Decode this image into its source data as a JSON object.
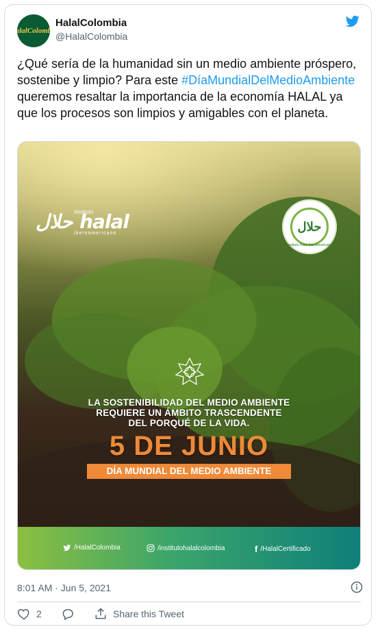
{
  "account": {
    "display_name": "HalalColombia",
    "handle": "@HalalColombia",
    "avatar_text": "HalalColombia"
  },
  "tweet": {
    "text_part1": "¿Qué sería de la humanidad sin un medio ambiente próspero, sostenibe y limpio? Para este ",
    "hashtag": "#DíaMundialDelMedioAmbiente",
    "text_part2": " queremos resaltar la importancia de la economía HALAL ya que los procesos son limpios y amigables con el planeta.",
    "timestamp": "8:01 AM · Jun 5, 2021",
    "like_count": "2",
    "share_label": "Share this Tweet"
  },
  "image": {
    "brand_top": "Instituto",
    "brand_main": "حلال halal",
    "brand_bottom": "iberoamericano",
    "seal_text": "حلال",
    "seal_caption": "Instituto Halal Iberoamericano",
    "message_line1": "LA SOSTENIBILIDAD DEL MEDIO AMBIENTE",
    "message_line2": "REQUIERE UN ÁMBITO TRASCENDENTE",
    "message_line3": "DEL PORQUÉ DE LA VIDA.",
    "date": "5 DE JUNIO",
    "day_label": "DÍA MUNDIAL DEL MEDIO AMBIENTE",
    "social_twitter": "/HalalColombia",
    "social_instagram": "/institutohalalcolombia",
    "social_facebook": "/HalalCertificado"
  },
  "colors": {
    "hashtag": "#1d9bf0",
    "accent_orange": "#ee8a38",
    "brand_green": "#0a5a33"
  }
}
